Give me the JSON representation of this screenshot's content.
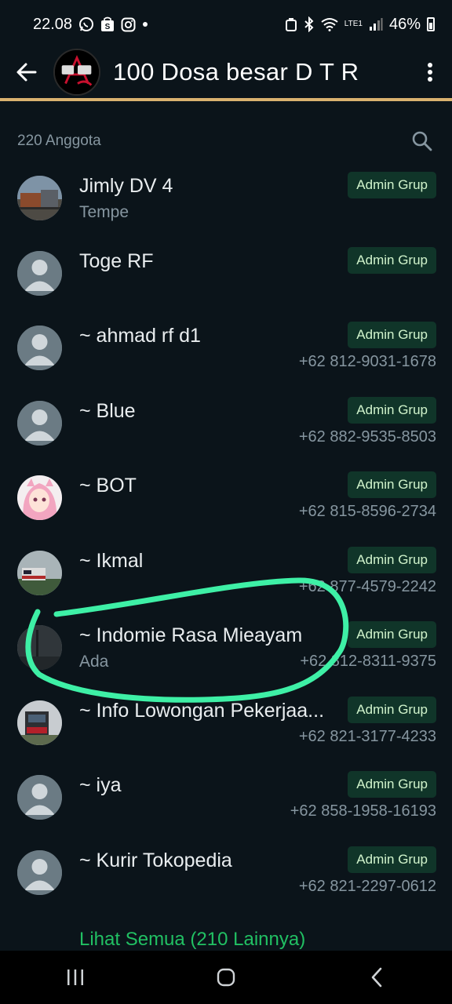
{
  "status_bar": {
    "time": "22.08",
    "battery": "46%",
    "network": "LTE1"
  },
  "header": {
    "title": "100 Dosa besar D T R"
  },
  "members": {
    "count_label": "220 Anggota",
    "items": [
      {
        "name": "Jimly DV 4",
        "subtitle": "Tempe",
        "badge": "Admin Grup",
        "phone": "",
        "avatar": "photo-train-depot"
      },
      {
        "name": "Toge RF",
        "subtitle": "",
        "badge": "Admin Grup",
        "phone": "",
        "avatar": "default-person"
      },
      {
        "name": "~ ahmad rf d1",
        "subtitle": "",
        "badge": "Admin Grup",
        "phone": "+62 812-9031-1678",
        "avatar": "default-person"
      },
      {
        "name": "~ Blue",
        "subtitle": "",
        "badge": "Admin Grup",
        "phone": "+62 882-9535-8503",
        "avatar": "default-person"
      },
      {
        "name": "~ BOT",
        "subtitle": "",
        "badge": "Admin Grup",
        "phone": "+62 815-8596-2734",
        "avatar": "anime-pink-hair"
      },
      {
        "name": "~ Ikmal",
        "subtitle": "",
        "badge": "Admin Grup",
        "phone": "+62 877-4579-2242",
        "avatar": "photo-train"
      },
      {
        "name": "~ Indomie Rasa Mieayam",
        "subtitle": "Ada",
        "badge": "Admin Grup",
        "phone": "+62 812-8311-9375",
        "avatar": "photo-dark"
      },
      {
        "name": "~ Info Lowongan Pekerjaa...",
        "subtitle": "",
        "badge": "Admin Grup",
        "phone": "+62 821-3177-4233",
        "avatar": "photo-train-red"
      },
      {
        "name": "~ iya",
        "subtitle": "",
        "badge": "Admin Grup",
        "phone": "+62 858-1958-16193",
        "avatar": "default-person"
      },
      {
        "name": "~ Kurir Tokopedia",
        "subtitle": "",
        "badge": "Admin Grup",
        "phone": "+62 821-2297-0612",
        "avatar": "default-person"
      }
    ],
    "see_all_label": "Lihat Semua (210 Lainnya)"
  },
  "colors": {
    "background": "#0b141a",
    "accent_line": "#d9b26f",
    "badge_bg": "#103529",
    "badge_text": "#d1f4cc",
    "link_green": "#21c063",
    "annotation_stroke": "#3ef0a6"
  },
  "icons": {
    "back": "arrow-left-icon",
    "menu": "more-vert-icon",
    "search": "search-icon"
  }
}
